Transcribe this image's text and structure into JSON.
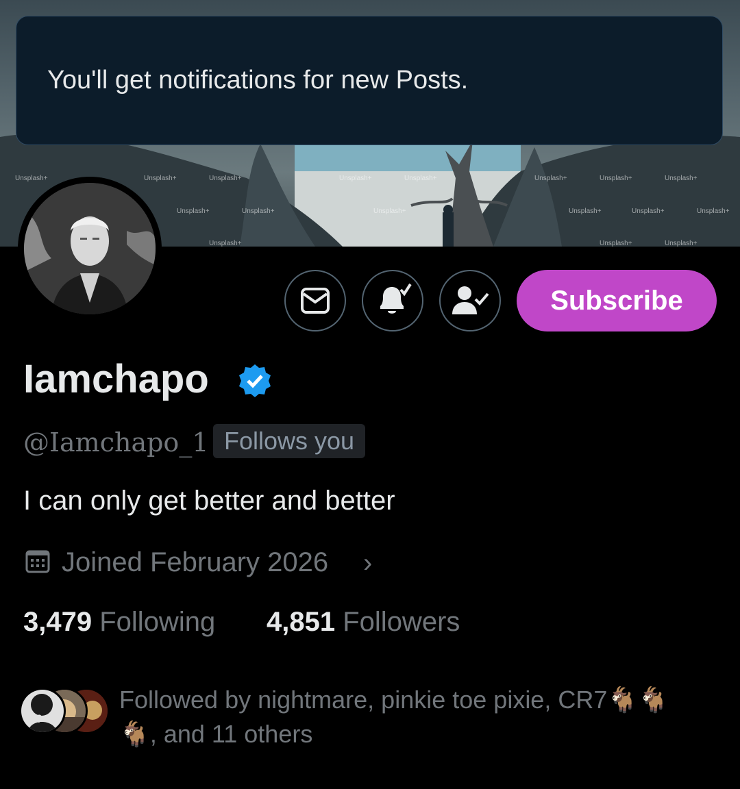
{
  "toast": {
    "message": "You'll get notifications for new Posts."
  },
  "banner": {
    "watermark": "Unsplash+"
  },
  "actions": {
    "subscribe_label": "Subscribe"
  },
  "profile": {
    "display_name": "Iamchapo",
    "handle": "@Iamchapo_1",
    "follows_you": "Follows you",
    "bio": "I can only get better and better",
    "joined": "Joined February 2026",
    "following_count": "3,479",
    "following_label": "Following",
    "followers_count": "4,851",
    "followers_label": "Followers",
    "followed_by_line1": "Followed by nightmare, pinkie toe pixie, CR7🐐🐐",
    "followed_by_line2": "🐐, and 11 others"
  },
  "colors": {
    "accent": "#c047c8",
    "verified": "#1d9bf0",
    "muted": "#71767b"
  },
  "icons": [
    "mail-icon",
    "bell-check-icon",
    "person-check-icon",
    "verified-badge-icon",
    "calendar-icon",
    "chevron-right-icon"
  ]
}
